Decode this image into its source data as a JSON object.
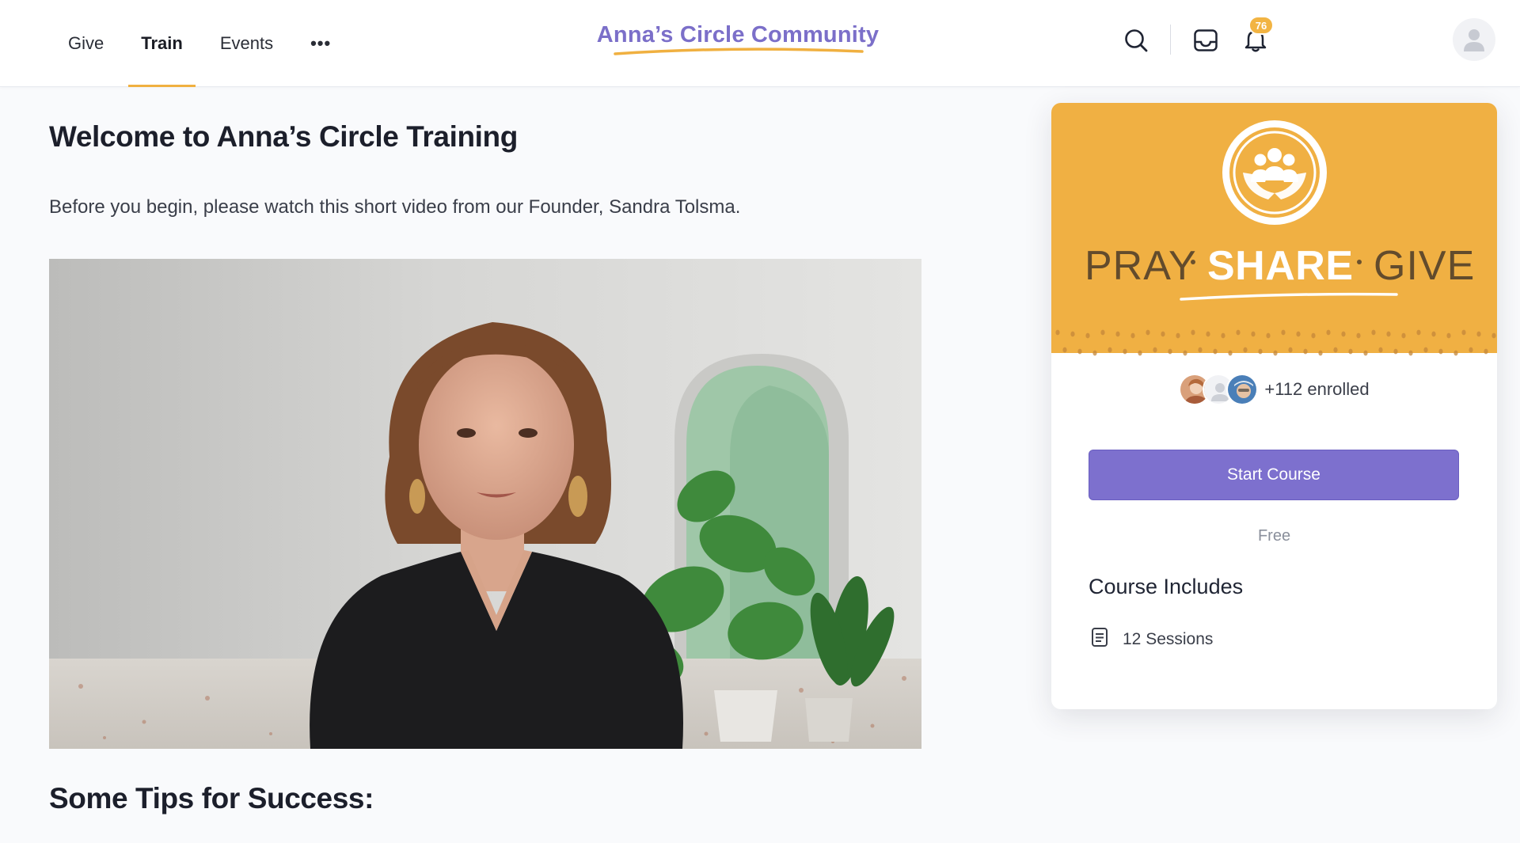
{
  "header": {
    "nav": [
      {
        "label": "Give",
        "active": false
      },
      {
        "label": "Train",
        "active": true
      },
      {
        "label": "Events",
        "active": false
      }
    ],
    "more_label": "•••",
    "brand": "Anna’s Circle Community",
    "notification_count": "76",
    "icons": [
      "search-icon",
      "inbox-icon",
      "bell-icon",
      "user-avatar-icon"
    ],
    "brand_color": "#7b6fc9",
    "accent_color": "#f0b040"
  },
  "main": {
    "title": "Welcome to Anna’s Circle Training",
    "intro": "Before you begin, please watch this short video from our Founder, Sandra Tolsma.",
    "tips_title": "Some Tips for Success:"
  },
  "course_card": {
    "banner_words": {
      "pray": "PRAY",
      "share": "SHARE",
      "give": "GIVE"
    },
    "banner_color": "#f0b043",
    "enrolled": "+112 enrolled",
    "start_label": "Start Course",
    "price": "Free",
    "includes_title": "Course Includes",
    "sessions": "12 Sessions",
    "button_color": "#7d70ce"
  }
}
